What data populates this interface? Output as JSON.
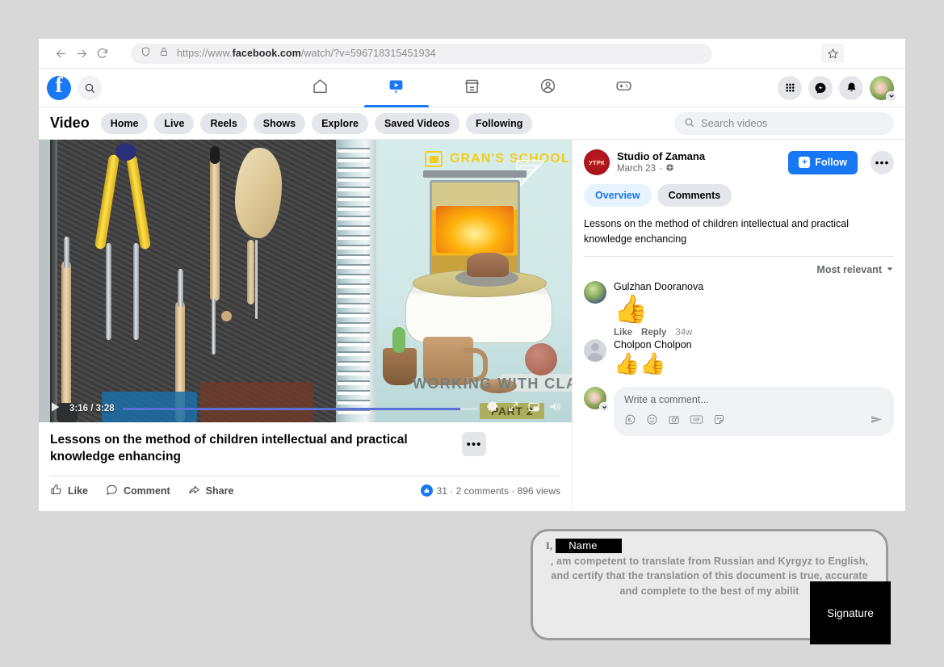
{
  "browser": {
    "url_prefix": "https://www.",
    "url_domain": "facebook.com",
    "url_path": "/watch/?v=596718315451934",
    "back_icon": "back-arrow-icon",
    "forward_icon": "forward-arrow-icon",
    "reload_icon": "reload-icon",
    "shield_icon": "shield-icon",
    "lock_icon": "lock-icon",
    "bookmark_icon": "star-icon"
  },
  "topnav": {
    "logo": "facebook-logo",
    "search_icon": "search-icon",
    "tabs": [
      {
        "name": "home",
        "icon": "home-icon",
        "active": false
      },
      {
        "name": "video",
        "icon": "video-icon",
        "active": true
      },
      {
        "name": "marketplace",
        "icon": "marketplace-icon",
        "active": false
      },
      {
        "name": "groups",
        "icon": "groups-icon",
        "active": false
      },
      {
        "name": "gaming",
        "icon": "gaming-icon",
        "active": false
      }
    ],
    "right": [
      {
        "name": "menu-grid",
        "icon": "grid-menu-icon"
      },
      {
        "name": "messenger",
        "icon": "messenger-icon"
      },
      {
        "name": "notifications",
        "icon": "bell-icon"
      },
      {
        "name": "account",
        "icon": "avatar-icon"
      }
    ]
  },
  "videobar": {
    "title": "Video",
    "pills": [
      "Home",
      "Live",
      "Reels",
      "Shows",
      "Explore",
      "Saved Videos",
      "Following"
    ],
    "search_placeholder": "Search videos",
    "search_icon": "search-icon"
  },
  "player": {
    "brand_overlay": "GRAN'S SCHOOL",
    "series_title": "WORKING WITH CLAY",
    "part_badge": "PART 2",
    "current_time": "3:16",
    "duration": "3:28",
    "time_display": "3:16 / 3:28",
    "progress_percent": 95,
    "play_icon": "play-icon",
    "settings_icon": "gear-icon",
    "fullscreen_icon": "fullscreen-icon",
    "pip_icon": "picture-in-picture-icon",
    "volume_icon": "volume-icon"
  },
  "video_info": {
    "title": "Lessons on the method of children intellectual and practical knowledge enhancing",
    "more_label": "•••",
    "actions": [
      {
        "label": "Like",
        "icon": "thumbs-up-icon"
      },
      {
        "label": "Comment",
        "icon": "comment-bubble-icon"
      },
      {
        "label": "Share",
        "icon": "share-arrow-icon"
      }
    ],
    "stats": "31 · 2 comments · 896 views",
    "reaction_count": "31",
    "comments_count": "2 comments",
    "views_count": "896 views"
  },
  "sidebar": {
    "poster_name": "Studio of Zamana",
    "poster_avatar_text": "УТРК",
    "post_date": "March 23",
    "privacy_icon": "globe-icon",
    "separator": "·",
    "follow_label": "Follow",
    "follow_icon": "follow-plus-icon",
    "more_label": "•••",
    "tabs": [
      {
        "label": "Overview",
        "selected": true
      },
      {
        "label": "Comments",
        "selected": false
      }
    ],
    "description": "Lessons on the method of children intellectual and practical knowledge enchancing",
    "sort_label": "Most relevant",
    "sort_icon": "chevron-down-icon",
    "comments": [
      {
        "author": "Gulzhan Dooranova",
        "emoji": "👍",
        "like_label": "Like",
        "reply_label": "Reply",
        "age": "34w",
        "avatar": "photo"
      },
      {
        "author": "Cholpon Cholpon",
        "emoji": "👍👍",
        "avatar": "blank"
      }
    ],
    "composer": {
      "placeholder": "Write a comment...",
      "icons": [
        "sticker-avatar-icon",
        "emoji-icon",
        "camera-icon",
        "gif-icon",
        "sticker-icon"
      ],
      "send_icon": "send-icon"
    }
  },
  "certification": {
    "lead": "I,",
    "name_redacted": "Name",
    "body": ", am competent to translate from Russian and Kyrgyz to English, and certify that the translation of this document is true, accurate and complete to the best of my abilit",
    "signature_redacted": "Signature"
  },
  "colors": {
    "brand_blue": "#1877f2",
    "chip_gray": "#e4e6eb",
    "text_primary": "#050505",
    "text_secondary": "#65676b",
    "brand_yellow": "#f2cf1c",
    "poster_red": "#b01720"
  }
}
